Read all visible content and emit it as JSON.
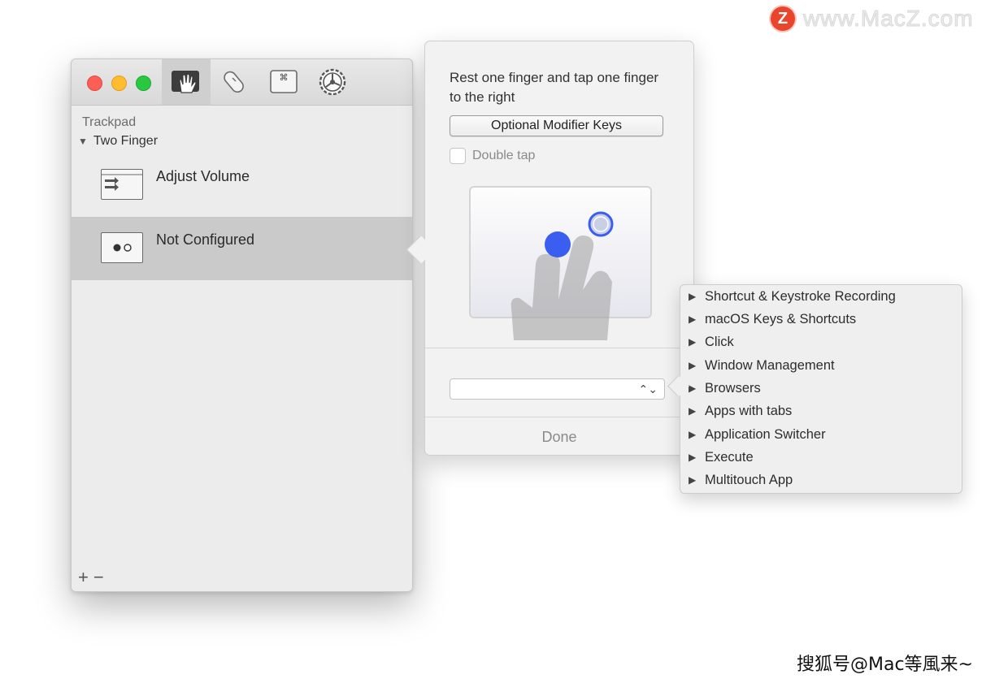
{
  "watermark": {
    "logo_letter": "Z",
    "site": "www.MacZ.com",
    "footer": "搜狐号@Mac等風来~"
  },
  "window": {
    "toolbar_icons": [
      "trackpad-hand-icon",
      "magic-mouse-icon",
      "keyboard-icon",
      "settings-gear-icon"
    ],
    "section_title": "Trackpad",
    "group_label": "Two Finger",
    "gestures": [
      {
        "label": "Adjust Volume",
        "icon": "swipe-arrows-icon"
      },
      {
        "label": "Not Configured",
        "icon": "rest-tap-icon",
        "selected": true
      }
    ],
    "footer": {
      "add": "+",
      "remove": "−"
    }
  },
  "popover": {
    "instruction": "Rest one finger and tap one finger to the right",
    "modifier_button": "Optional Modifier Keys",
    "double_tap_label": "Double tap",
    "double_tap_checked": false,
    "action_select_value": "",
    "done_label": "Done"
  },
  "menu": {
    "items": [
      "Shortcut & Keystroke Recording",
      "macOS Keys & Shortcuts",
      "Click",
      "Window Management",
      "Browsers",
      "Apps with tabs",
      "Application Switcher",
      "Execute",
      "Multitouch App"
    ]
  },
  "colors": {
    "accent_blue": "#3a5ef0",
    "selected_row": "#cacaca"
  }
}
